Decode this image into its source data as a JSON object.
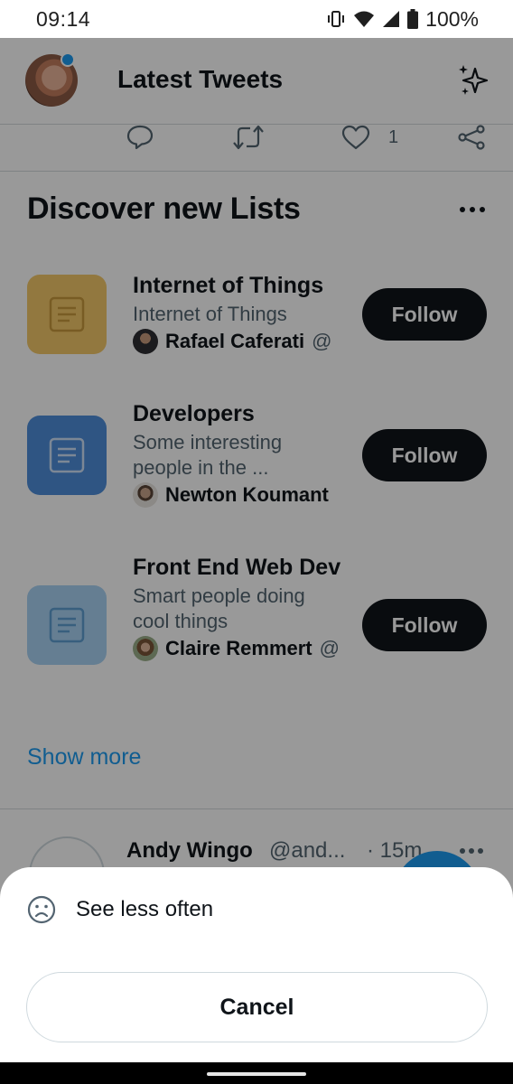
{
  "status_bar": {
    "time": "09:14",
    "battery": "100%",
    "icons": [
      "vibrate-icon",
      "wifi-icon",
      "signal-icon",
      "battery-icon"
    ]
  },
  "header": {
    "title": "Latest Tweets",
    "sparkle_icon": "sparkle-icon",
    "has_notification_dot": true
  },
  "prev_tweet_actions": {
    "like_count": "1"
  },
  "discover": {
    "title": "Discover new Lists",
    "lists": [
      {
        "name": "Internet of Things",
        "description": "Internet of Things",
        "owner": "Rafael Caferati",
        "handle": "@",
        "follow_label": "Follow",
        "icon_color": "#f4c86a"
      },
      {
        "name": "Developers",
        "description": "Some interesting people in the ...",
        "owner": "Newton Koumant",
        "handle": "",
        "follow_label": "Follow",
        "icon_color": "#4f8edb"
      },
      {
        "name": "Front End Web Dev",
        "description": "Smart people doing cool things",
        "owner": "Claire Remmert",
        "handle": "@",
        "follow_label": "Follow",
        "icon_color": "#a9d3f3"
      }
    ],
    "show_more": "Show more"
  },
  "next_tweet": {
    "name": "Andy Wingo",
    "handle": "@and...",
    "time": "· 15m"
  },
  "sheet": {
    "see_less_label": "See less often",
    "cancel_label": "Cancel"
  },
  "colors": {
    "accent": "#1d9bf0",
    "text": "#0f1419",
    "secondary": "#536471"
  }
}
